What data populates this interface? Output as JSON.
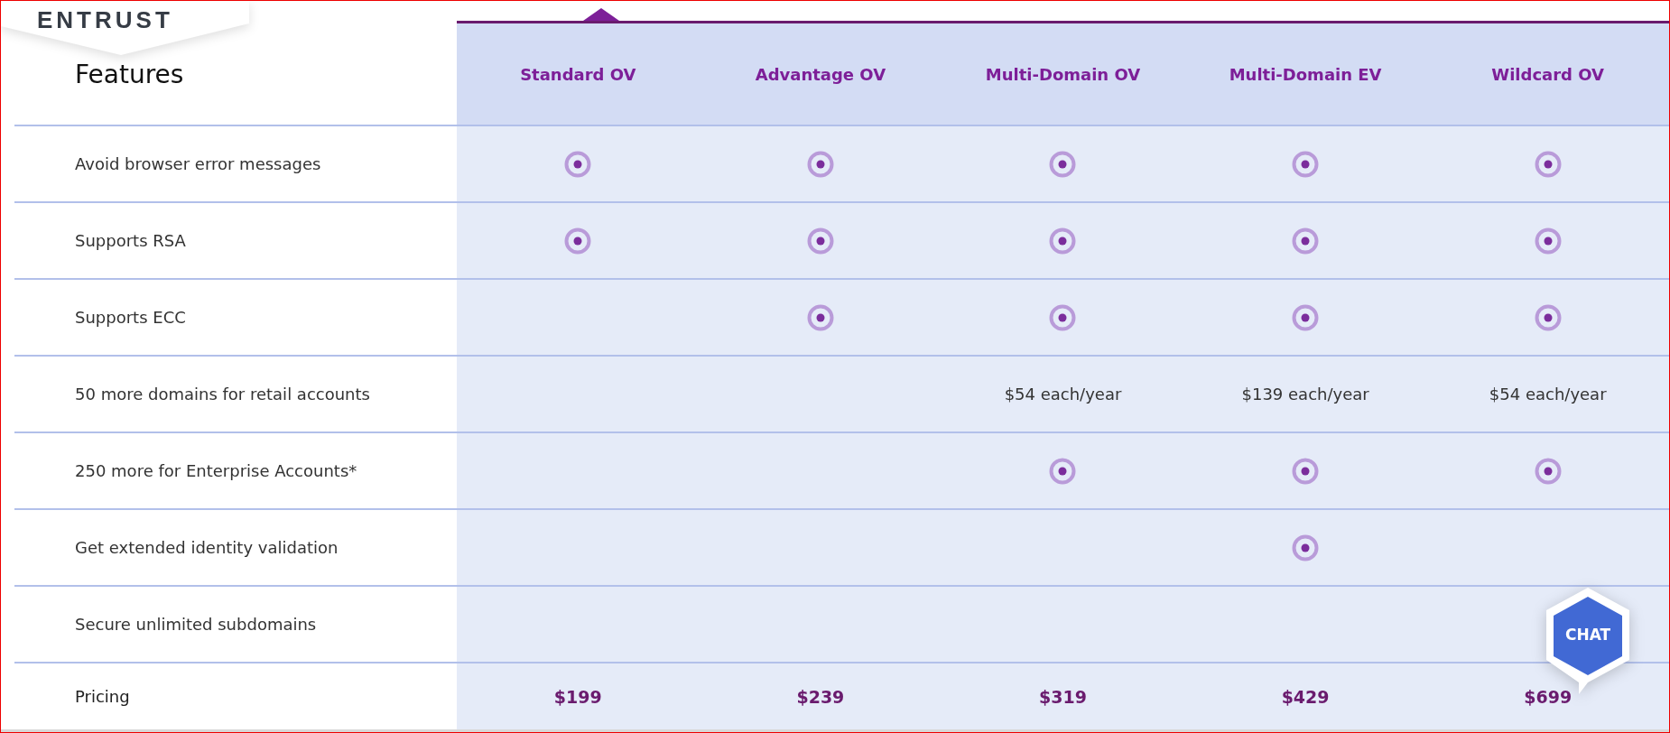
{
  "logo": {
    "text": "ENTRUST"
  },
  "table": {
    "heading": "Features",
    "columns": [
      "Standard OV",
      "Advantage OV",
      "Multi-Domain OV",
      "Multi-Domain EV",
      "Wildcard OV"
    ],
    "rows": [
      {
        "feature": "Avoid browser error messages",
        "cells": [
          {
            "kind": "check"
          },
          {
            "kind": "check"
          },
          {
            "kind": "check"
          },
          {
            "kind": "check"
          },
          {
            "kind": "check"
          }
        ]
      },
      {
        "feature": "Supports RSA",
        "cells": [
          {
            "kind": "check"
          },
          {
            "kind": "check"
          },
          {
            "kind": "check"
          },
          {
            "kind": "check"
          },
          {
            "kind": "check"
          }
        ]
      },
      {
        "feature": "Supports ECC",
        "cells": [
          {
            "kind": "empty"
          },
          {
            "kind": "check"
          },
          {
            "kind": "check"
          },
          {
            "kind": "check"
          },
          {
            "kind": "check"
          }
        ]
      },
      {
        "feature": "50 more domains for retail accounts",
        "cells": [
          {
            "kind": "empty"
          },
          {
            "kind": "empty"
          },
          {
            "kind": "text",
            "text": "$54 each/year"
          },
          {
            "kind": "text",
            "text": "$139 each/year"
          },
          {
            "kind": "text",
            "text": "$54 each/year"
          }
        ]
      },
      {
        "feature": "250 more for Enterprise Accounts*",
        "cells": [
          {
            "kind": "empty"
          },
          {
            "kind": "empty"
          },
          {
            "kind": "check"
          },
          {
            "kind": "check"
          },
          {
            "kind": "check"
          }
        ]
      },
      {
        "feature": "Get extended identity validation",
        "cells": [
          {
            "kind": "empty"
          },
          {
            "kind": "empty"
          },
          {
            "kind": "empty"
          },
          {
            "kind": "check"
          },
          {
            "kind": "empty"
          }
        ]
      },
      {
        "feature": "Secure unlimited subdomains",
        "cells": [
          {
            "kind": "empty"
          },
          {
            "kind": "empty"
          },
          {
            "kind": "empty"
          },
          {
            "kind": "empty"
          },
          {
            "kind": "empty"
          }
        ]
      }
    ],
    "pricing": {
      "label": "Pricing",
      "prices": [
        "$199",
        "$239",
        "$319",
        "$429",
        "$699"
      ]
    }
  },
  "chat": {
    "label": "CHAT"
  }
}
